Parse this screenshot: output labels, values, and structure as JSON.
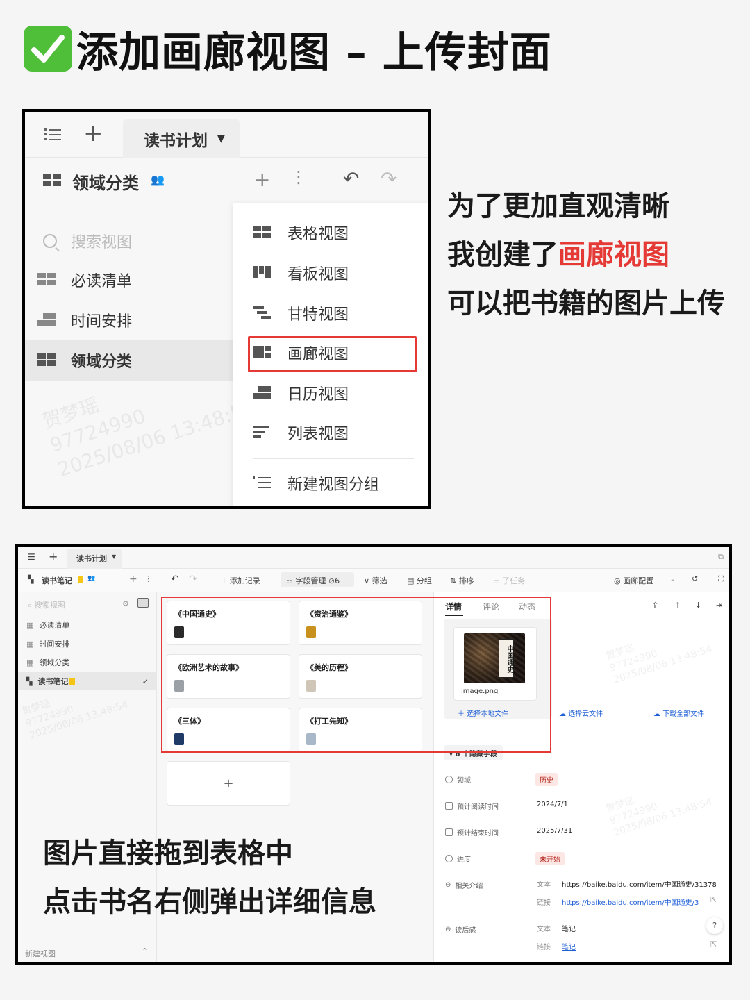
{
  "title": {
    "check": "✓",
    "text": "添加画廊视图 – 上传封面"
  },
  "panel1": {
    "tab_label": "读书计划",
    "table_name": "领域分类",
    "search_placeholder": "搜索视图",
    "sidebar_items": [
      {
        "label": "必读清单"
      },
      {
        "label": "时间安排"
      },
      {
        "label": "领域分类"
      }
    ],
    "menu_items": [
      {
        "label": "表格视图",
        "icon": "table-view-icon"
      },
      {
        "label": "看板视图",
        "icon": "kanban-view-icon"
      },
      {
        "label": "甘特视图",
        "icon": "gantt-view-icon"
      },
      {
        "label": "画廊视图",
        "icon": "gallery-view-icon"
      },
      {
        "label": "日历视图",
        "icon": "calendar-view-icon"
      },
      {
        "label": "列表视图",
        "icon": "list-view-icon"
      }
    ],
    "new_group": "新建视图分组",
    "watermark": "贺梦瑶\n97724990\n2025/08/06 13:48:54"
  },
  "description": {
    "line1": "为了更加直观清晰",
    "line2_prefix": "我创建了",
    "line2_highlight": "画廊视图",
    "line3": "可以把书籍的图片上传"
  },
  "panel2": {
    "tab_label": "读书计划",
    "table_name": "读书笔记",
    "toolbar": {
      "add_record": "添加记录",
      "field_manage": "字段管理",
      "hidden_count": "6",
      "filter": "筛选",
      "group": "分组",
      "sort": "排序",
      "subtask": "子任务",
      "gallery_config": "画廊配置"
    },
    "search_placeholder": "搜索视图",
    "sidebar_items": [
      {
        "label": "必读清单"
      },
      {
        "label": "时间安排"
      },
      {
        "label": "领域分类"
      },
      {
        "label": "读书笔记"
      }
    ],
    "new_view": "新建视图",
    "cards": [
      {
        "title": "《中国通史》",
        "thumb_color": "#2b2b2b"
      },
      {
        "title": "《资治通鉴》",
        "thumb_color": "#c8901c"
      },
      {
        "title": "《欧洲艺术的故事》",
        "thumb_color": "#9aa0a6"
      },
      {
        "title": "《美的历程》",
        "thumb_color": "#cfc6b8"
      },
      {
        "title": "《三体》",
        "thumb_color": "#1f3a66"
      },
      {
        "title": "《打工先知》",
        "thumb_color": "#a9b8c8"
      }
    ],
    "add_card": "+",
    "detail": {
      "tabs": [
        "详情",
        "评论",
        "动态"
      ],
      "image_name": "image.png",
      "cover_text": "中国通史",
      "select_local": "选择本地文件",
      "select_cloud": "选择云文件",
      "download_all": "下载全部文件",
      "hidden_fields": "6 个隐藏字段",
      "fields": {
        "domain_label": "领域",
        "domain_value": "历史",
        "start_label": "预计阅读时间",
        "start_value": "2024/7/1",
        "end_label": "预计结束时间",
        "end_value": "2025/7/31",
        "progress_label": "进度",
        "progress_value": "未开始",
        "intro_label": "相关介绍",
        "intro_text_tag": "文本",
        "intro_text_value": "https://baike.baidu.com/item/中国通史/31378",
        "intro_link_tag": "链接",
        "intro_link_value": "https://baike.baidu.com/item/中国通史/3",
        "review_label": "读后感",
        "review_text_tag": "文本",
        "review_text_value": "笔记",
        "review_link_tag": "链接",
        "review_link_value": "笔记"
      }
    },
    "watermark": "贺梦瑶\n97724990\n2025/08/06 13:48:54"
  },
  "captions": {
    "line1": "图片直接拖到表格中",
    "line2": "点击书名右侧弹出详细信息"
  },
  "colors": {
    "accent_red": "#e53935",
    "check_green": "#4fbf3a",
    "link_blue": "#1f5fd6"
  }
}
